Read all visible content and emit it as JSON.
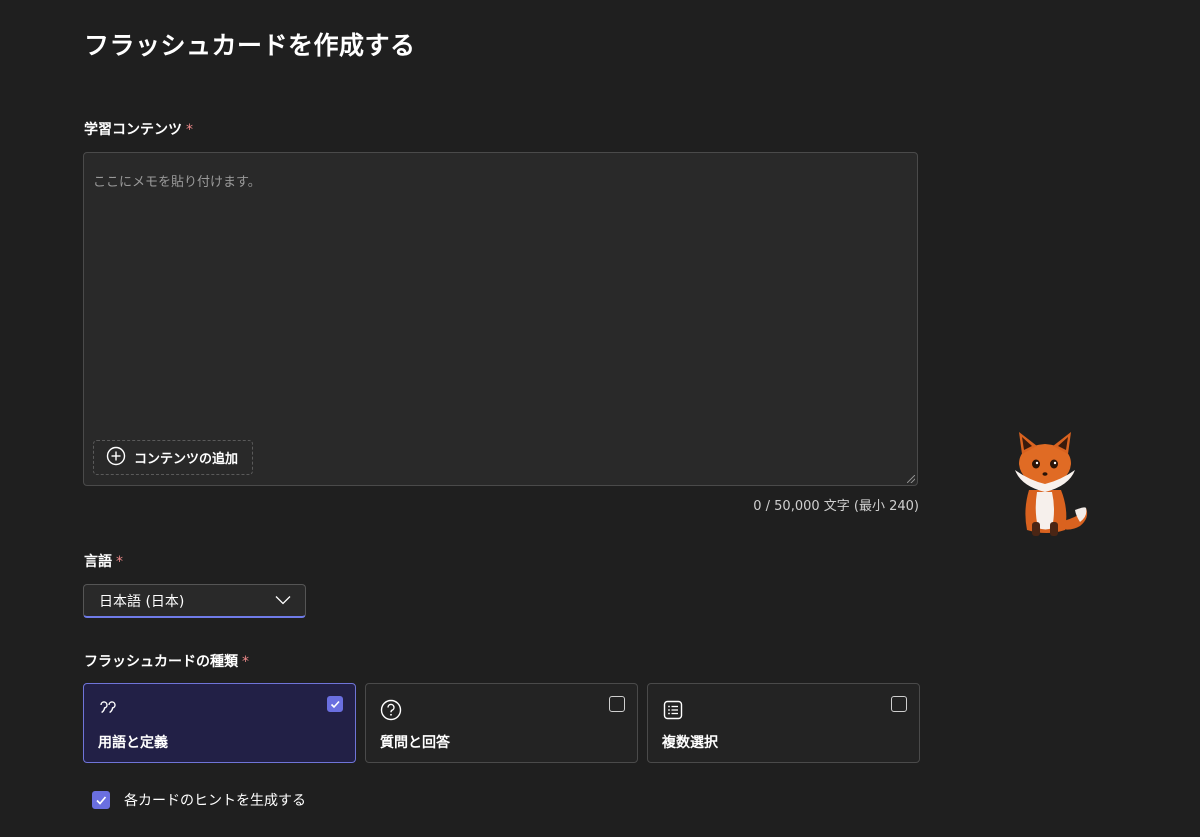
{
  "page": {
    "title": "フラッシュカードを作成する"
  },
  "content_section": {
    "label": "学習コンテンツ",
    "required_mark": "*",
    "placeholder": "ここにメモを貼り付けます。",
    "value": "",
    "add_button_label": "コンテンツの追加",
    "char_count": "0 / 50,000 文字 (最小 240)"
  },
  "language_section": {
    "label": "言語",
    "required_mark": "*",
    "selected": "日本語 (日本)"
  },
  "type_section": {
    "label": "フラッシュカードの種類",
    "required_mark": "*",
    "options": [
      {
        "label": "用語と定義",
        "icon": "quote-icon",
        "checked": true
      },
      {
        "label": "質問と回答",
        "icon": "question-circle-icon",
        "checked": false
      },
      {
        "label": "複数選択",
        "icon": "list-icon",
        "checked": false
      }
    ]
  },
  "hint_option": {
    "label": "各カードのヒントを生成する",
    "checked": true
  },
  "colors": {
    "background": "#1f1f1f",
    "accent": "#6a6fe0",
    "required": "#f08a8a",
    "selected_card_bg": "#222046"
  }
}
